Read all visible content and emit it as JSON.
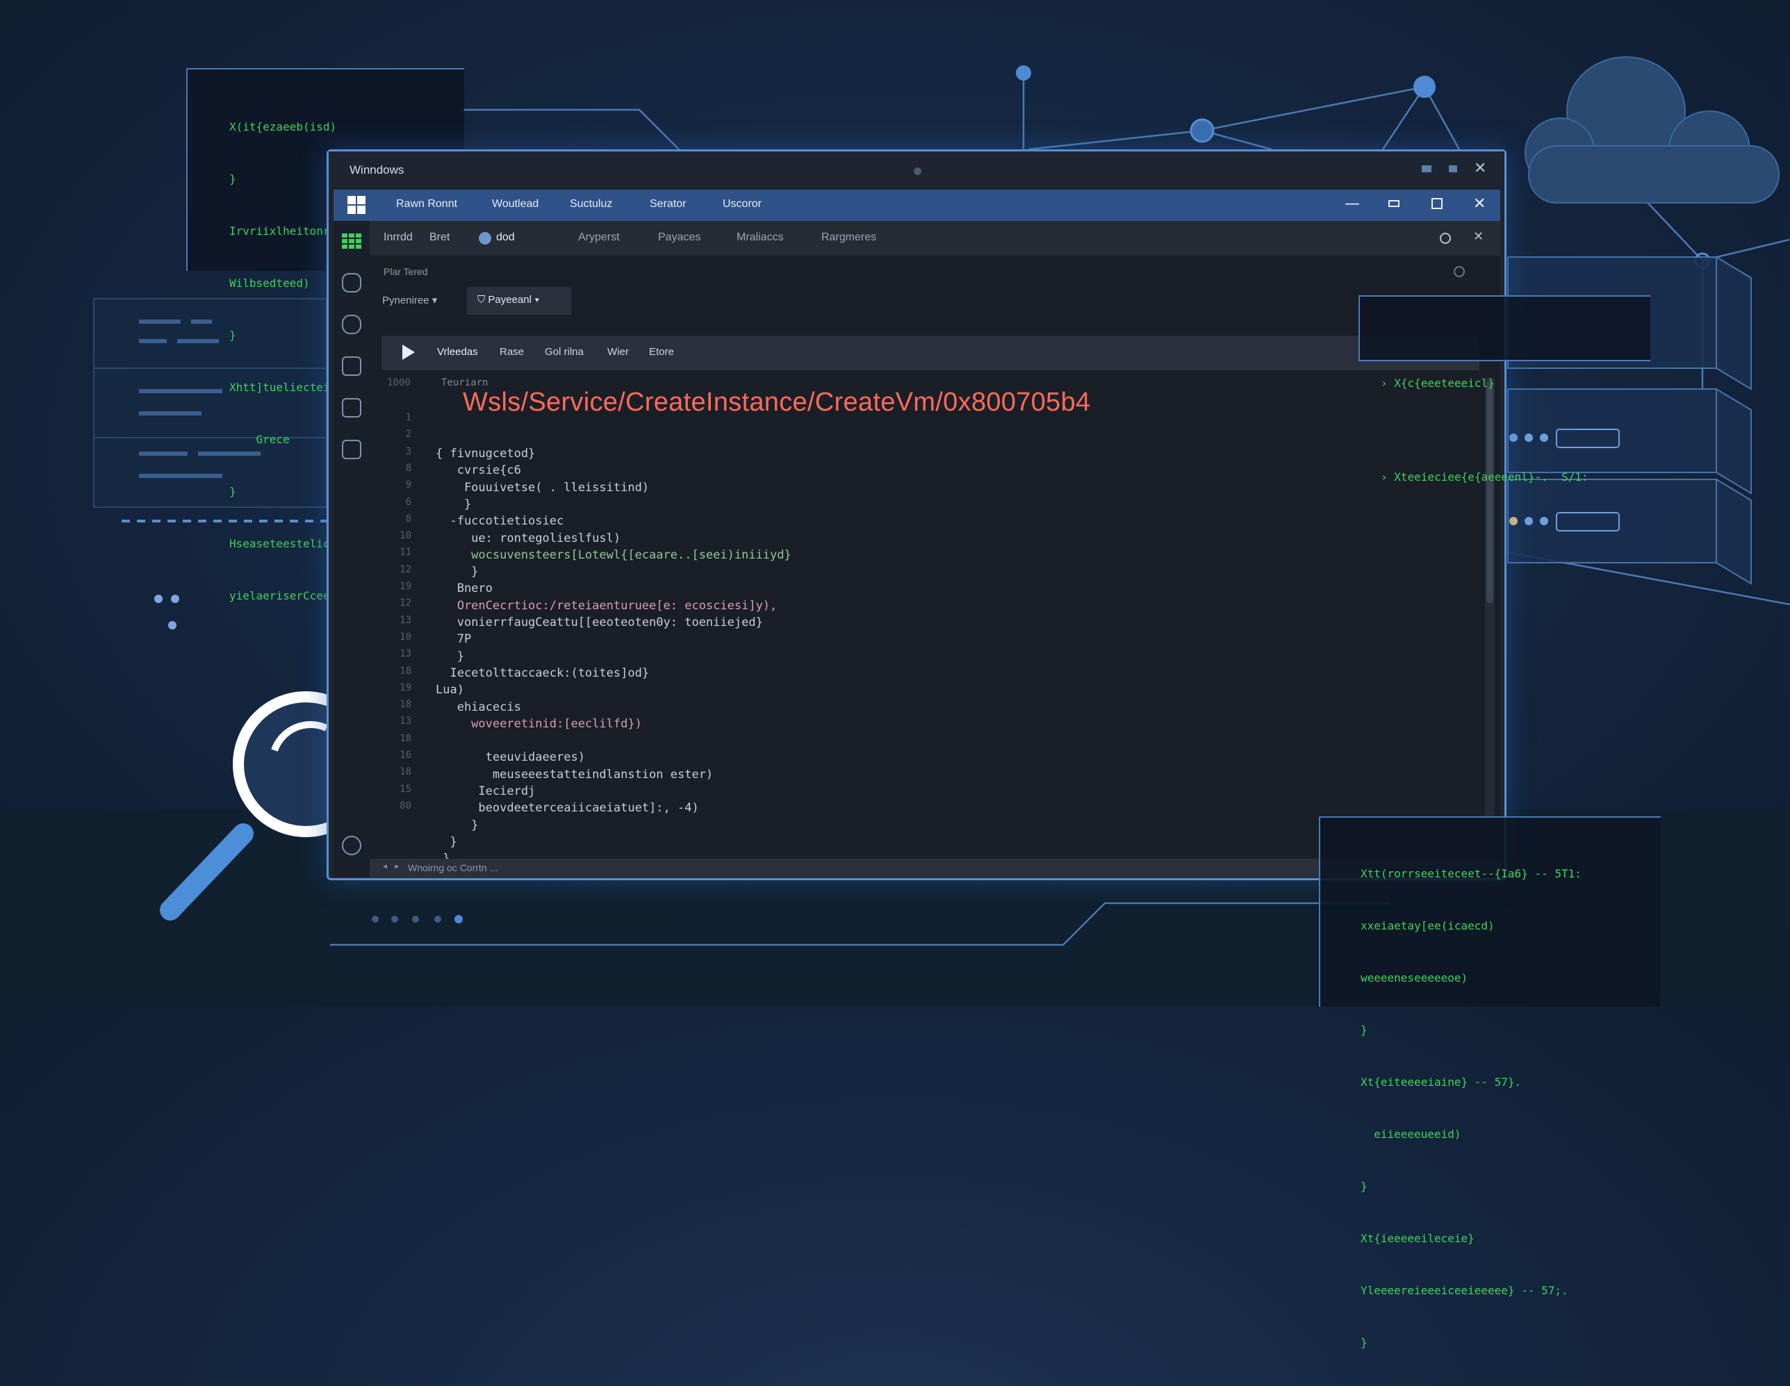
{
  "window": {
    "outer_title": "Winndows",
    "app_menu": [
      "Rawn Ronnt",
      "Woutlead",
      "Suctuluz",
      "Serator",
      "Uscoror"
    ],
    "toolbar_items": [
      "Inrrdd",
      "Bret",
      "dod",
      "Aryperst",
      "Payaces",
      "Mraliaccs",
      "Rargmeres"
    ],
    "breadcrumb": "Plar Tered",
    "tabs": [
      "Pyneniree",
      "Payeeanl"
    ],
    "run_bar_items": [
      "Vrleedas",
      "Rase",
      "Gol rilna",
      "Wier",
      "Etore"
    ],
    "editor_header_num": "1000",
    "editor_header_label": "Teuriarn",
    "error_path": "Wsls/Service/CreateInstance/CreateVm/0x800705b4",
    "status_text": "Wnoirng oc Corrtn ...",
    "line_numbers": [
      "1",
      "2",
      "3",
      "8",
      "9",
      "6",
      "8",
      "10",
      "11",
      "12",
      "19",
      "12",
      "13",
      "10",
      "13",
      "18",
      "19",
      "18",
      "13",
      "18",
      "16",
      "18",
      "15",
      "80"
    ],
    "code_lines": [
      "{ fivnugcetod}",
      "   cvrsie{c6",
      "    Fouuivetse( . lleissitind)",
      "    }",
      "  -fuccotietiosiec",
      "     ue: rontegolieslfusl)",
      "     wocsuvensteers[Lotewl{[ecaare..[seei)iniiiyd}",
      "     }",
      "   Bnero",
      "   OrenCecrtioc:/reteiaenturuee[e: ecosciesi]y),",
      "   vonierrfaugCeattu[[eeoteoten0y: toeniiejed}",
      "   7P",
      "   }",
      "  Iecetolttaccaeck:(toites]od}",
      "Lua)",
      "   ehiacecis",
      "     woveeretinid:[eeclilfd})",
      "",
      "       teeuvidaeeres)",
      "        meuseeestatteindlanstion ester)",
      "      Iecierdj",
      "      beovdeeterceaiicaeiatuet]:, -4)",
      "     }",
      "  }",
      " }"
    ]
  },
  "left_terminal": [
    "X(it{ezaeeb(isd)",
    "}",
    "Irvriixlheitonrecf)",
    "Wilbsedteed)",
    "}",
    "Xhtt]tueliecteic",
    "    Grece",
    "}",
    "Hseaseteestelic",
    "yielaeriserCceer"
  ],
  "right_popup": [
    "X{c{eeeteeeicl}",
    "Xteeieciee{e{aeeeenl}-.  S/1:"
  ],
  "bottom_right_terminal": [
    "Xtt(rorrseeiteceet--{Ia6} -- 5T1:",
    "xxeiaetay[ee(icaecd)",
    "weeeeneseeeeeoe)",
    "}",
    "Xt{eiteeeeiaine} -- 57}.",
    "  eiieeeeueeid)",
    "}",
    "Xt{ieeeeeileceie}",
    "Yleeeereieeeiceeieeeee} -- 57;.",
    "}"
  ],
  "colors": {
    "error_red": "#ff6a5a",
    "accent_blue": "#2f5288",
    "terminal_green": "#3fd35a"
  },
  "icons": [
    "windows-logo-icon",
    "grid-app-icon",
    "folder-icon",
    "db-icon",
    "file-icon",
    "mail-icon",
    "doc-icon",
    "settings-icon",
    "play-icon",
    "refresh-icon",
    "close-icon",
    "magnifier-icon",
    "cloud-icon"
  ]
}
